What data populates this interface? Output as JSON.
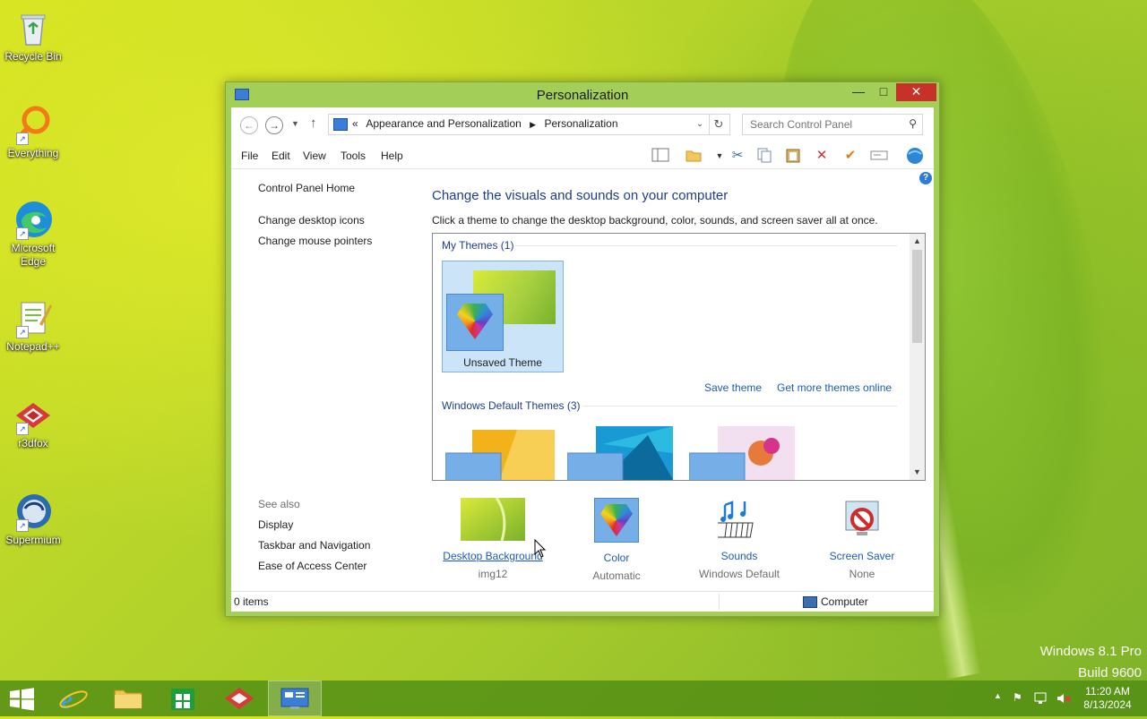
{
  "desktop": {
    "icons": [
      {
        "label": "Recycle Bin"
      },
      {
        "label": "Everything"
      },
      {
        "label": "Microsoft Edge"
      },
      {
        "label": "Notepad++"
      },
      {
        "label": "r3dfox"
      },
      {
        "label": "Supermium"
      }
    ],
    "watermark": {
      "line1": "Windows 8.1 Pro",
      "line2": "Build 9600"
    }
  },
  "window": {
    "title": "Personalization",
    "breadcrumb": {
      "prefix": "«",
      "items": [
        "Appearance and Personalization",
        "Personalization"
      ]
    },
    "search_placeholder": "Search Control Panel",
    "menu": [
      "File",
      "Edit",
      "View",
      "Tools",
      "Help"
    ],
    "left_pane": {
      "home": "Control Panel Home",
      "links": [
        "Change desktop icons",
        "Change mouse pointers"
      ],
      "see_also_label": "See also",
      "see_also": [
        "Display",
        "Taskbar and Navigation",
        "Ease of Access Center"
      ]
    },
    "heading": "Change the visuals and sounds on your computer",
    "subtext": "Click a theme to change the desktop background, color, sounds, and screen saver all at once.",
    "themes": {
      "my_themes_header": "My Themes (1)",
      "selected_theme": "Unsaved Theme",
      "save_theme": "Save theme",
      "get_more": "Get more themes online",
      "default_header": "Windows Default Themes (3)"
    },
    "settings": [
      {
        "name": "Desktop Background",
        "value": "img12"
      },
      {
        "name": "Color",
        "value": "Automatic"
      },
      {
        "name": "Sounds",
        "value": "Windows Default"
      },
      {
        "name": "Screen Saver",
        "value": "None"
      }
    ],
    "status": {
      "items": "0 items",
      "location": "Computer"
    }
  },
  "taskbar": {
    "clock_time": "11:20 AM",
    "clock_date": "8/13/2024"
  },
  "colors": {
    "accent": "#a3cf58",
    "link": "#1c5bb8",
    "close": "#c7312a"
  }
}
